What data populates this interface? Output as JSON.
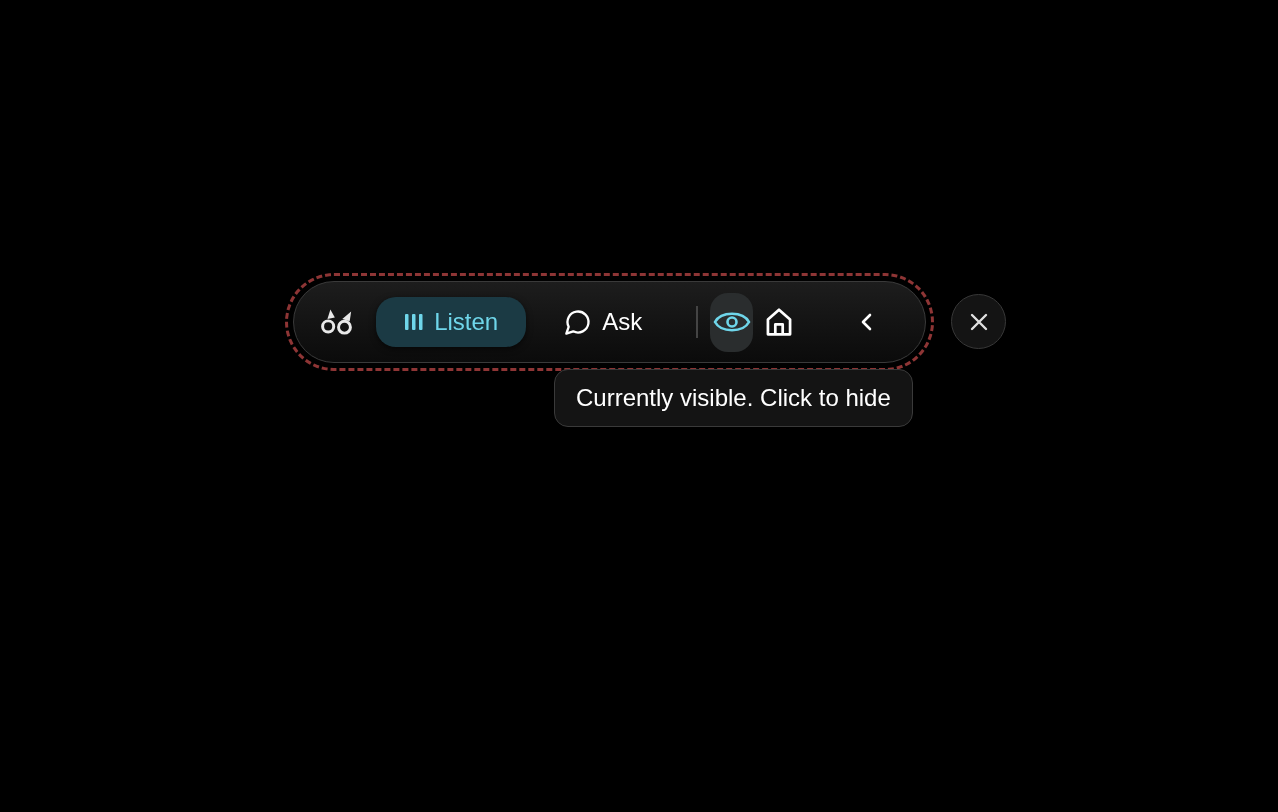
{
  "toolbar": {
    "focused": true,
    "modes": [
      {
        "kind": "listen",
        "label": "Listen",
        "selected": true
      },
      {
        "kind": "ask",
        "label": "Ask",
        "selected": false
      }
    ],
    "actions": [
      {
        "kind": "visibility",
        "active": true
      },
      {
        "kind": "home",
        "active": false
      },
      {
        "kind": "collapse",
        "active": false
      }
    ]
  },
  "tooltip": {
    "text": "Currently visible. Click to hide"
  },
  "close_button": {
    "kind": "close"
  }
}
